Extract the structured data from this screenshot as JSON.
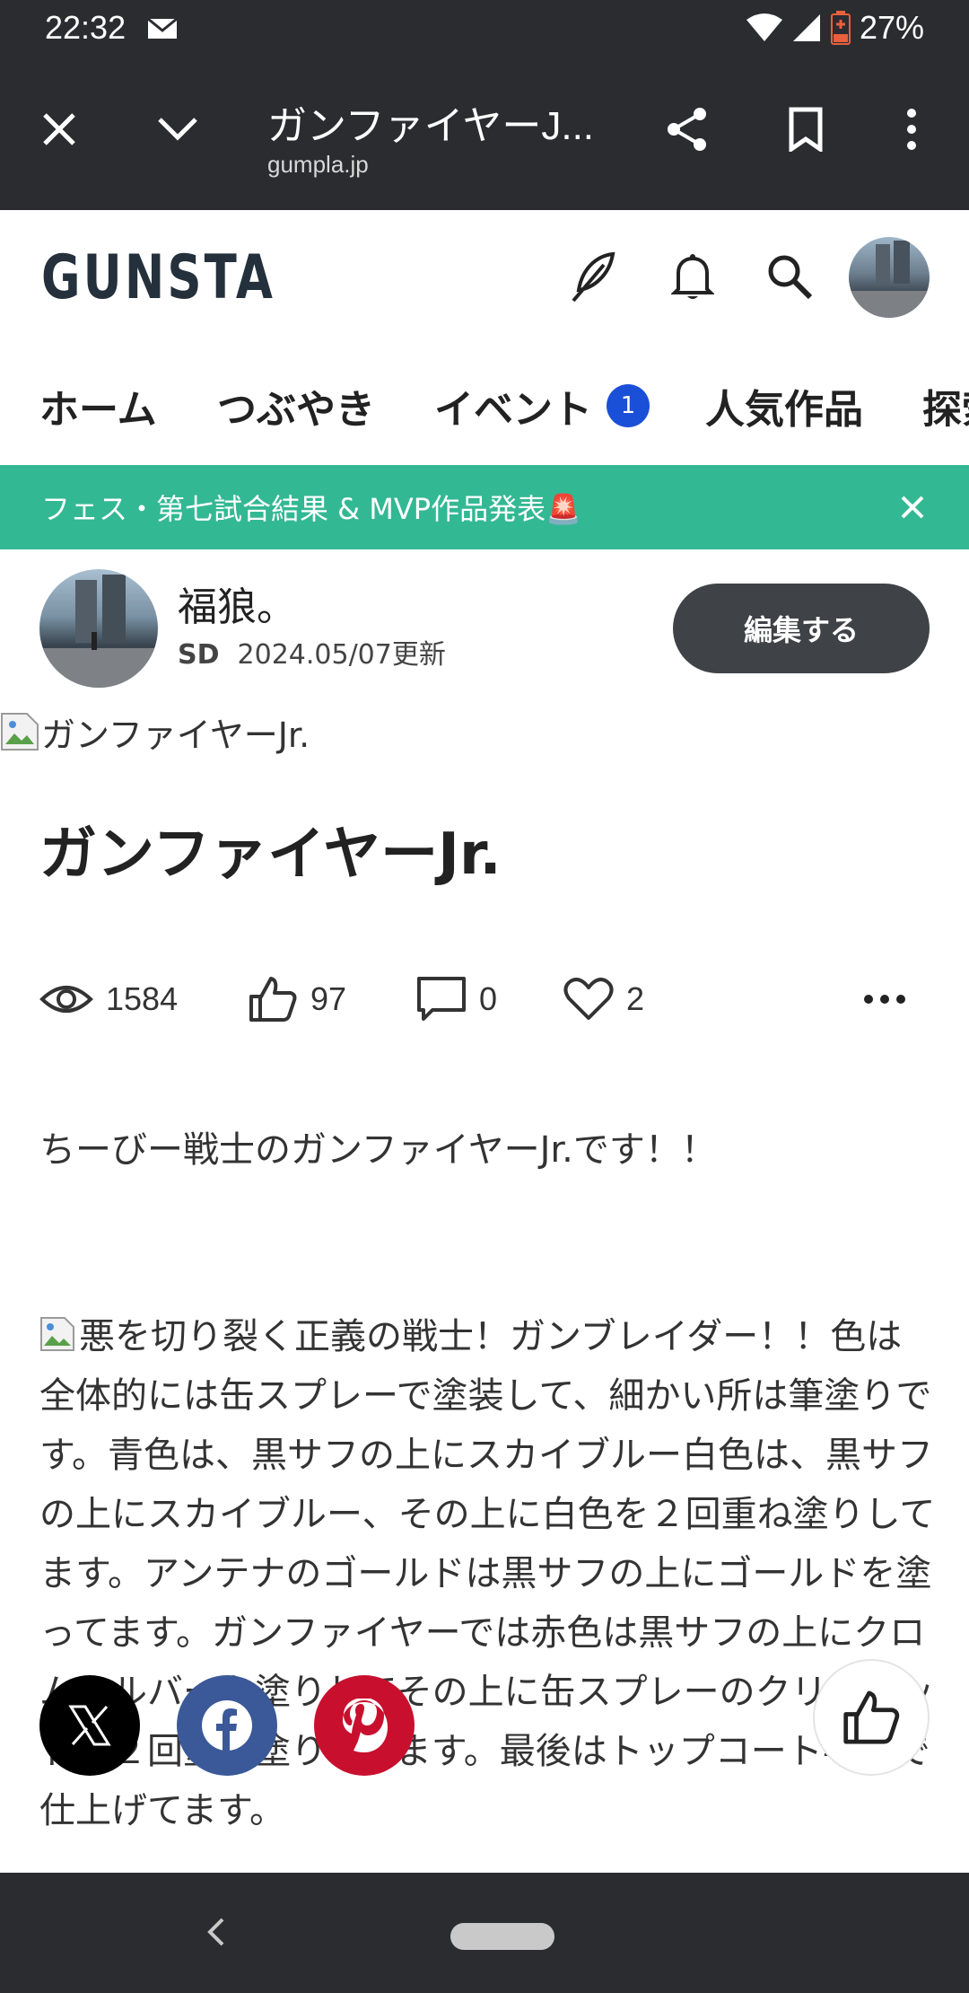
{
  "status_bar": {
    "time": "22:32",
    "battery": "27%",
    "icons": [
      "mail-icon",
      "wifi-icon",
      "signal-icon",
      "battery-icon"
    ]
  },
  "browser": {
    "title": "ガンファイヤーJ...",
    "domain": "gumpla.jp",
    "icons": [
      "close-icon",
      "chevron-down-icon",
      "share-icon",
      "bookmark-icon",
      "more-vert-icon"
    ]
  },
  "site": {
    "logo": "GUNSTA",
    "header_icons": [
      "feather-icon",
      "bell-icon",
      "search-icon"
    ]
  },
  "nav": {
    "items": [
      {
        "label": "ホーム"
      },
      {
        "label": "つぶやき"
      },
      {
        "label": "イベント",
        "badge": "1"
      },
      {
        "label": "人気作品"
      },
      {
        "label": "探索"
      }
    ]
  },
  "banner": {
    "text": "フェス・第七試合結果 & MVP作品発表🚨"
  },
  "author": {
    "name": "福狼。",
    "tag": "SD",
    "updated": "2024.05/07更新",
    "edit_label": "編集する"
  },
  "post": {
    "image_alt": "ガンファイヤーJr.",
    "title": "ガンファイヤーJr.",
    "stats": {
      "views": "1584",
      "likes": "97",
      "comments": "0",
      "favorites": "2"
    },
    "lead": "ちーびー戦士のガンファイヤーJr.です！！",
    "body": "悪を切り裂く正義の戦士！ガンブレイダー！！色は全体的には缶スプレーで塗装して、細かい所は筆塗りです。青色は、黒サフの上にスカイブルー白色は、黒サフの上にスカイブルー、その上に白色を２回重ね塗りしてます。アンテナのゴールドは黒サフの上にゴールドを塗ってます。ガンファイヤーでは赤色は黒サフの上にクロムシルバーを塗りしてその上に缶スプレーのクリアレッドを２回重ね塗りしてます。最後はトップコート半光で仕上げてます。"
  },
  "colors": {
    "chrome_bg": "#2b2c30",
    "banner_bg": "#33b894",
    "badge_bg": "#1a4fd8",
    "edit_btn_bg": "#3f4246",
    "x_bg": "#000000",
    "facebook_bg": "#3b5998",
    "pinterest_bg": "#c8102e"
  }
}
